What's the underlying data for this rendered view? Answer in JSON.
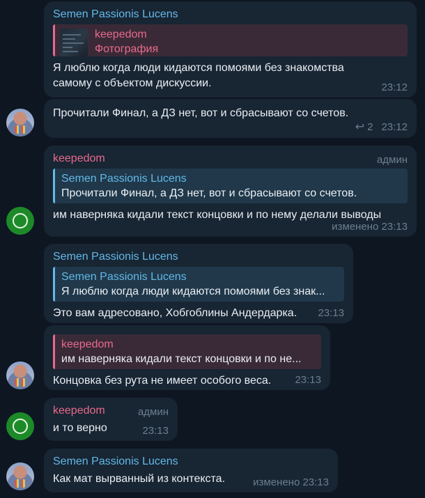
{
  "messages": [
    {
      "sender": "Semen Passionis Lucens",
      "reply": {
        "name": "keepedom",
        "text": "Фотография"
      },
      "text": "Я люблю когда люди кидаются помоями без знакомства самому с объектом дискуссии.",
      "time": "23:12"
    },
    {
      "text": "Прочитали Финал, а ДЗ нет, вот и сбрасывают со счетов.",
      "replies_count": "2",
      "time": "23:12"
    },
    {
      "sender": "keepedom",
      "badge": "админ",
      "reply": {
        "name": "Semen Passionis Lucens",
        "text": "Прочитали Финал, а ДЗ нет, вот и сбрасывают со счетов."
      },
      "text": "им наверняка кидали текст концовки и по нему делали выводы",
      "time": "изменено 23:13"
    },
    {
      "sender": "Semen Passionis Lucens",
      "reply": {
        "name": "Semen Passionis Lucens",
        "text": "Я люблю когда люди кидаются помоями без знак..."
      },
      "text": "Это вам адресовано, Хобгоблины Андердарка.",
      "time": "23:13"
    },
    {
      "reply": {
        "name": "keepedom",
        "text": "им наверняка кидали текст концовки и по не..."
      },
      "text": "Концовка без рута не имеет особого веса.",
      "time": "23:13"
    },
    {
      "sender": "keepedom",
      "badge": "админ",
      "text": "и то верно",
      "time": "23:13"
    },
    {
      "sender": "Semen Passionis Lucens",
      "text": "Как мат вырванный из контекста.",
      "time": "изменено 23:13"
    }
  ]
}
